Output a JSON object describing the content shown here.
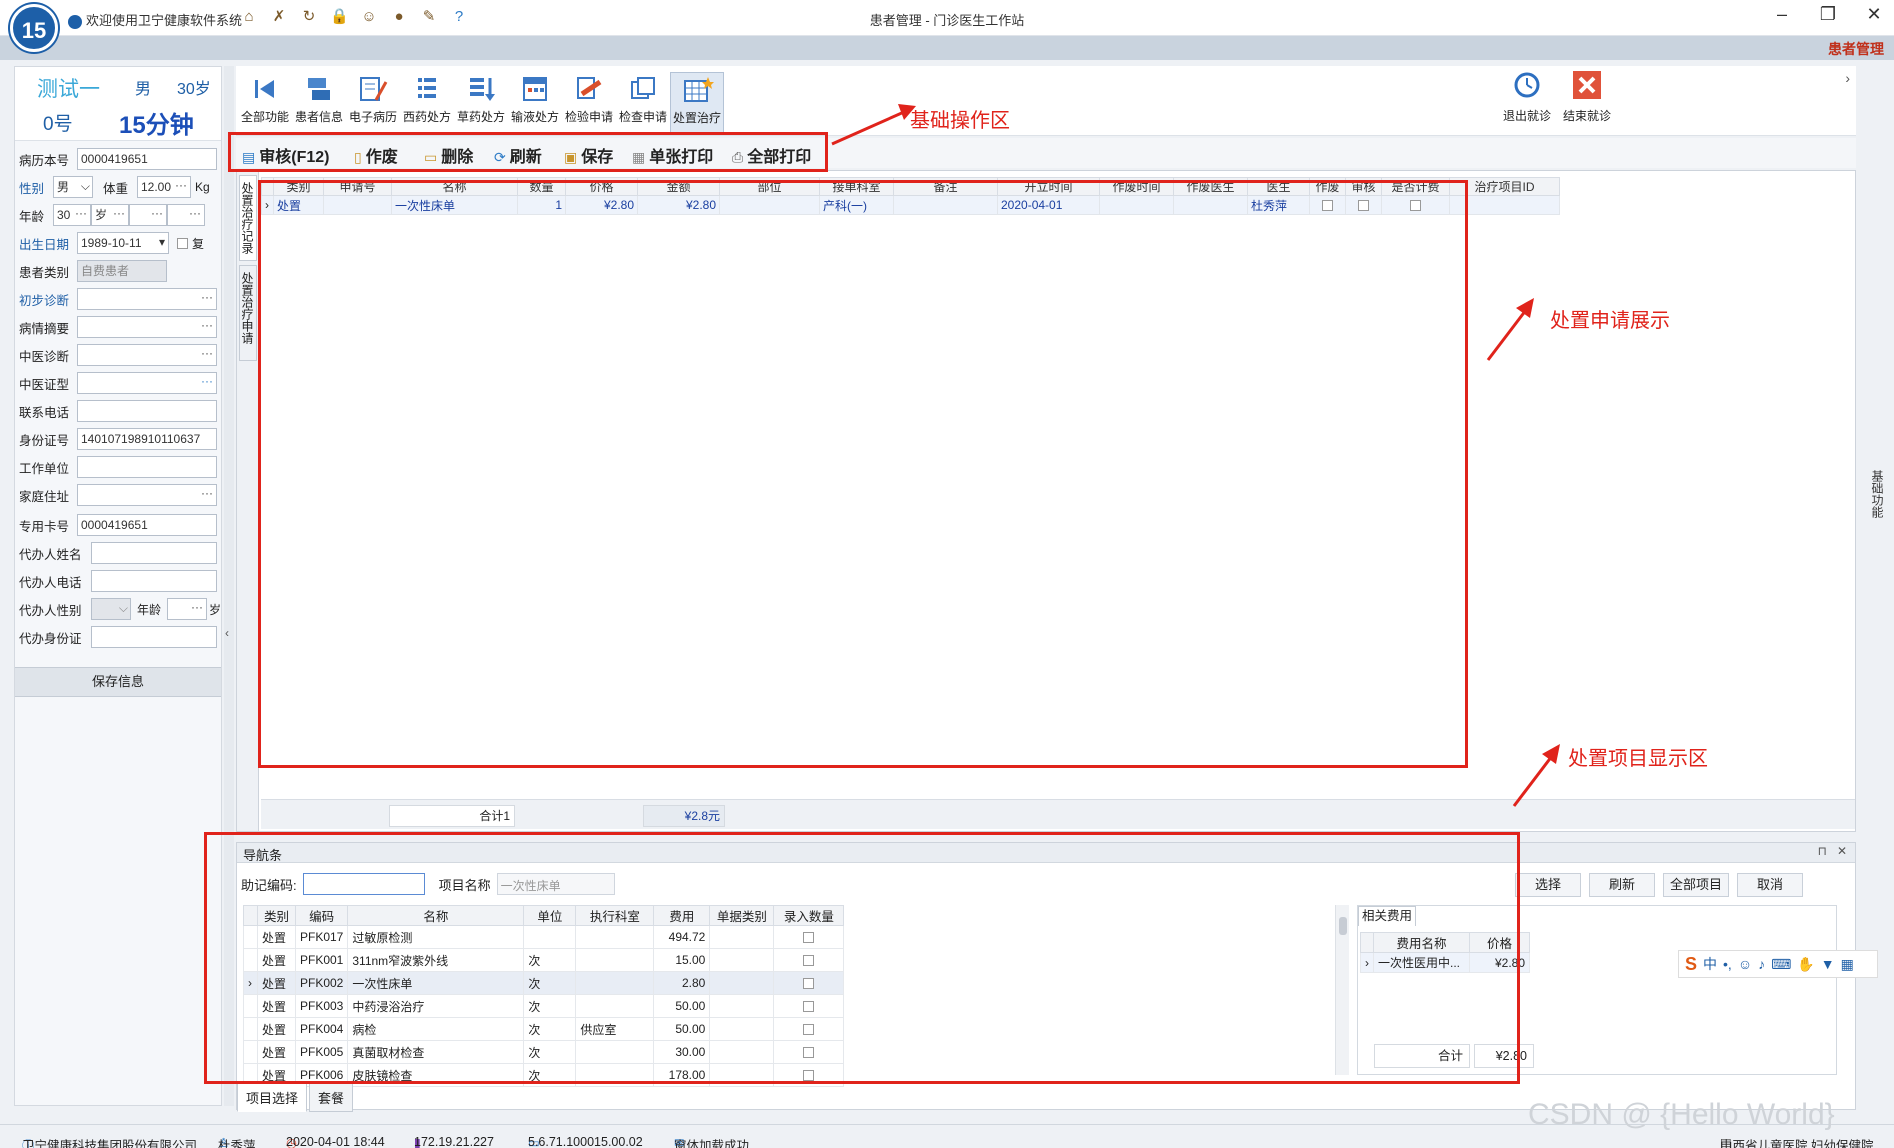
{
  "app": {
    "welcome": "欢迎使用卫宁健康软件系统",
    "window_title": "患者管理 - 门诊医生工作站",
    "logo_text": "15",
    "module_label": "患者管理"
  },
  "patient": {
    "name": "测试一",
    "sex": "男",
    "age": "30岁",
    "number": "0号",
    "wait": "15分钟"
  },
  "form": {
    "record_no_label": "病历本号",
    "record_no": "0000419651",
    "sex_label": "性别",
    "sex": "男",
    "weight_label": "体重",
    "weight": "12.00",
    "weight_unit": "Kg",
    "age_label": "年龄",
    "age": "30",
    "age_unit": "岁",
    "birth_label": "出生日期",
    "birth": "1989-10-11",
    "birth_flag": "复",
    "category_label": "患者类别",
    "category": "自费患者",
    "diag_label": "初步诊断",
    "summary_label": "病情摘要",
    "tcm_diag_label": "中医诊断",
    "tcm_type_label": "中医证型",
    "phone_label": "联系电话",
    "idcard_label": "身份证号",
    "idcard": "140107198910110637",
    "work_label": "工作单位",
    "addr_label": "家庭住址",
    "card_label": "专用卡号",
    "card": "0000419651",
    "agent_name_label": "代办人姓名",
    "agent_phone_label": "代办人电话",
    "agent_sex_label": "代办人性别",
    "agent_age_label": "年龄",
    "agent_age_unit": "岁",
    "agent_id_label": "代办身份证",
    "save": "保存信息"
  },
  "toolbar": {
    "items": [
      "全部功能",
      "患者信息",
      "电子病历",
      "西药处方",
      "草药处方",
      "输液处方",
      "检验申请",
      "检查申请",
      "处置治疗"
    ],
    "exit": "退出就诊",
    "finish": "结束就诊"
  },
  "actions": {
    "audit": "审核(F12)",
    "void": "作废",
    "delete": "删除",
    "refresh": "刷新",
    "save": "保存",
    "print_one": "单张打印",
    "print_all": "全部打印"
  },
  "side_tabs": {
    "records": "处置治疗记录",
    "apply": "处置治疗申请",
    "basic": "基础功能"
  },
  "grid": {
    "headers": [
      "类别",
      "申请号",
      "名称",
      "数量",
      "价格",
      "金额",
      "部位",
      "接单科室",
      "备注",
      "开立时间",
      "作废时间",
      "作废医生",
      "医生",
      "作废",
      "审核",
      "是否计费",
      "治疗项目ID"
    ],
    "rows": [
      {
        "category": "处置",
        "apply_no": "",
        "name": "一次性床单",
        "qty": "1",
        "price": "¥2.80",
        "amount": "¥2.80",
        "site": "",
        "dept": "产科(一)",
        "note": "",
        "time": "2020-04-01",
        "void_time": "",
        "void_doc": "",
        "doctor": "杜秀萍",
        "item_id": ""
      }
    ],
    "sum_label": "合计1",
    "sum_amount": "¥2.8元"
  },
  "nav": {
    "title": "导航条",
    "code_label": "助记编码:",
    "name_label": "项目名称",
    "name_placeholder": "一次性床单",
    "buttons": [
      "选择",
      "刷新",
      "全部项目",
      "取消"
    ],
    "headers": [
      "类别",
      "编码",
      "名称",
      "单位",
      "执行科室",
      "费用",
      "单据类别",
      "录入数量"
    ],
    "rows": [
      {
        "cat": "处置",
        "code": "PFK017",
        "name": "过敏原检测",
        "unit": "",
        "dept": "",
        "fee": "494.72"
      },
      {
        "cat": "处置",
        "code": "PFK001",
        "name": "311nm窄波紫外线",
        "unit": "次",
        "dept": "",
        "fee": "15.00"
      },
      {
        "cat": "处置",
        "code": "PFK002",
        "name": "一次性床单",
        "unit": "次",
        "dept": "",
        "fee": "2.80"
      },
      {
        "cat": "处置",
        "code": "PFK003",
        "name": "中药浸浴治疗",
        "unit": "次",
        "dept": "",
        "fee": "50.00"
      },
      {
        "cat": "处置",
        "code": "PFK004",
        "name": "病检",
        "unit": "次",
        "dept": "供应室",
        "fee": "50.00"
      },
      {
        "cat": "处置",
        "code": "PFK005",
        "name": "真菌取材检查",
        "unit": "次",
        "dept": "",
        "fee": "30.00"
      },
      {
        "cat": "处置",
        "code": "PFK006",
        "name": "皮肤镜检查",
        "unit": "次",
        "dept": "",
        "fee": "178.00"
      }
    ],
    "related_tab": "相关费用",
    "related_headers": [
      "费用名称",
      "价格"
    ],
    "related_rows": [
      {
        "name": "一次性医用中...",
        "price": "¥2.80"
      }
    ],
    "related_sum_label": "合计",
    "related_sum": "¥2.80",
    "tabs": [
      "项目选择",
      "套餐"
    ]
  },
  "status": {
    "company": "卫宁健康科技集团股份有限公司",
    "user": "杜秀萍",
    "datetime": "2020-04-01 18:44",
    "ip": "172.19.21.227",
    "version": "5.6.71.100015.00.02",
    "message": "窗体加载成功.....",
    "hospital": "山西省儿童医院 妇幼保健院"
  },
  "annotations": {
    "basic_ops": "基础操作区",
    "apply_display": "处置申请展示",
    "item_display": "处置项目显示区"
  },
  "ime": {
    "s": "S",
    "label": "中"
  },
  "watermark": "CSDN @ {Hello World}",
  "colors": {
    "annotation": "#e0231b",
    "accent": "#1d5fa8"
  }
}
